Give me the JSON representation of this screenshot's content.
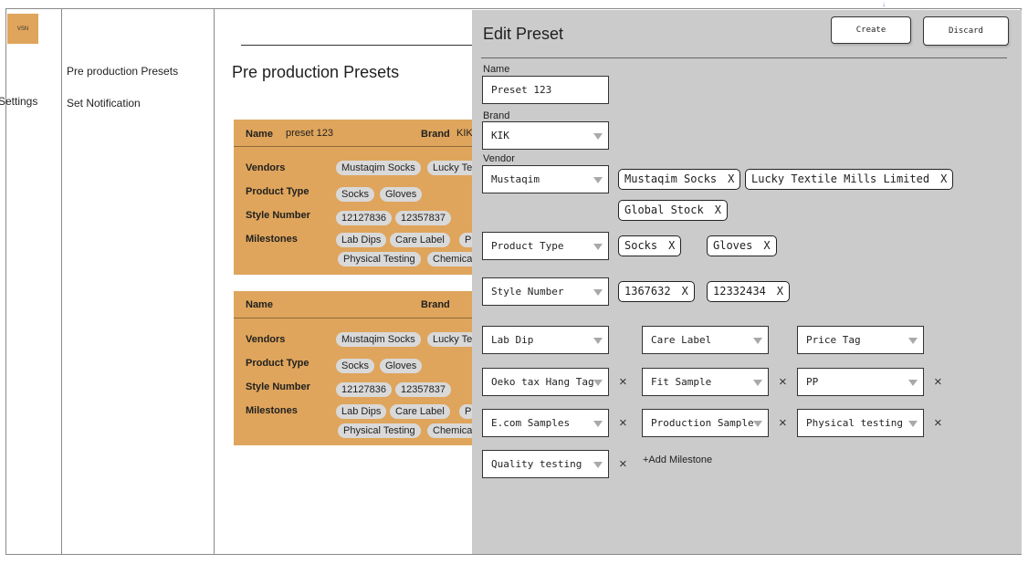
{
  "rail": {
    "logo": "VSN",
    "settings": "Settings"
  },
  "subnav": {
    "items": [
      "Pre production Presets",
      "Set Notification"
    ]
  },
  "main": {
    "title": "Pre production Presets",
    "cards": [
      {
        "name_label": "Name",
        "name_value": "preset 123",
        "brand_label": "Brand",
        "brand_value": "KIK",
        "vendors_label": "Vendors",
        "vendors": [
          "Mustaqim Socks",
          "Lucky Te"
        ],
        "product_type_label": "Product Type",
        "product_types": [
          "Socks",
          "Gloves"
        ],
        "style_label": "Style Number",
        "styles": [
          "12127836",
          "12357837"
        ],
        "milestones_label": "Milestones",
        "milestones_row1": [
          "Lab Dips",
          "Care Label",
          "Pr"
        ],
        "milestones_row2": [
          "Physical Testing",
          "Chemica"
        ]
      },
      {
        "name_label": "Name",
        "name_value": "",
        "brand_label": "Brand",
        "brand_value": "",
        "vendors_label": "Vendors",
        "vendors": [
          "Mustaqim Socks",
          "Lucky Te"
        ],
        "product_type_label": "Product Type",
        "product_types": [
          "Socks",
          "Gloves"
        ],
        "style_label": "Style Number",
        "styles": [
          "12127836",
          "12357837"
        ],
        "milestones_label": "Milestones",
        "milestones_row1": [
          "Lab Dips",
          "Care Label",
          "P"
        ],
        "milestones_row2": [
          "Physical Testing",
          "Chemica"
        ]
      }
    ]
  },
  "panel": {
    "title": "Edit Preset",
    "create_label": "Create",
    "discard_label": "Discard",
    "name_label": "Name",
    "name_value": "Preset 123",
    "brand_label": "Brand",
    "brand_value": "KIK",
    "vendor_label": "Vendor",
    "vendor_value": "Mustaqim",
    "vendor_chips": [
      "Mustaqim Socks",
      "Lucky Textile Mills Limited",
      "Global Stock"
    ],
    "product_type_value": "Product Type",
    "product_type_chips": [
      "Socks",
      "Gloves"
    ],
    "style_value": "Style Number",
    "style_chips": [
      "1367632",
      "12332434"
    ],
    "chip_remove": "X",
    "milestones": [
      "Lab Dip",
      "Care Label",
      "Price Tag",
      "Oeko tax Hang Tag",
      "Fit Sample",
      "PP",
      "E.com Samples",
      "Production Sample",
      "Physical testing",
      "Quality testing"
    ],
    "remove_icon": "×",
    "add_milestone": "+Add Milestone"
  },
  "colors": {
    "card_bg": "#dfa55c",
    "panel_bg": "#cccbcb",
    "pill_bg": "#d9d9d9"
  },
  "scroll_marker": "↓"
}
